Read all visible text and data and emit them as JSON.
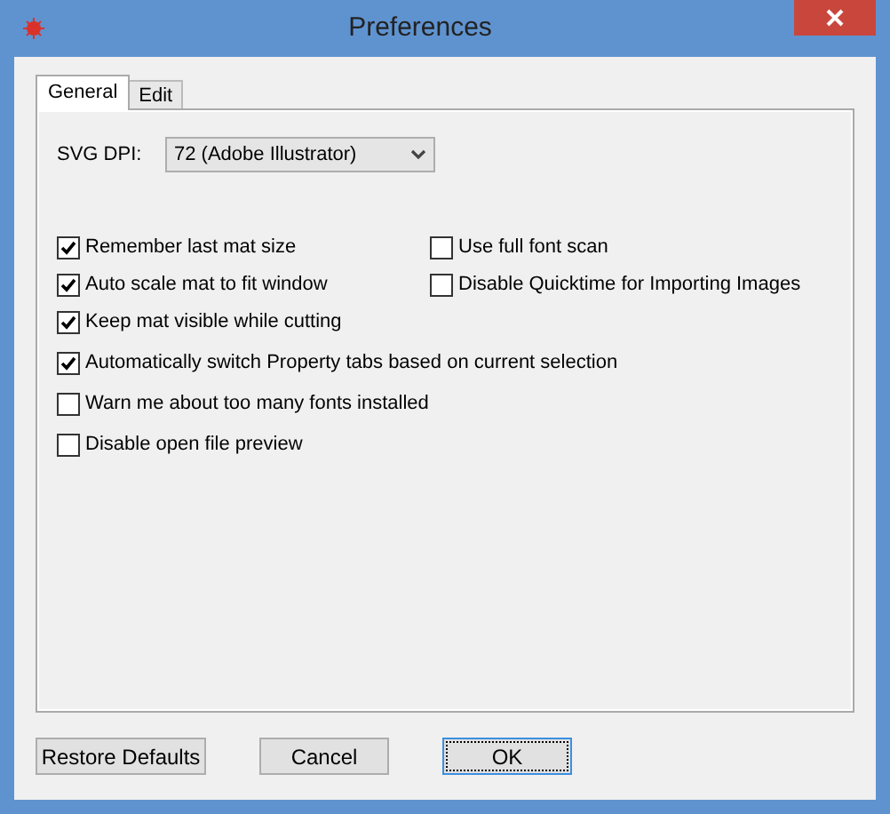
{
  "window": {
    "title": "Preferences"
  },
  "tabs": [
    {
      "label": "General",
      "selected": true
    },
    {
      "label": "Edit",
      "selected": false
    }
  ],
  "svg_dpi": {
    "label": "SVG DPI:",
    "value": "72 (Adobe Illustrator)"
  },
  "options": [
    {
      "label": "Remember last mat size",
      "checked": true
    },
    {
      "label": "Auto scale mat to fit window",
      "checked": true
    },
    {
      "label": "Keep mat visible while cutting",
      "checked": true
    },
    {
      "label": "Automatically switch Property tabs based on current selection",
      "checked": true
    },
    {
      "label": "Warn me about too many fonts installed",
      "checked": false
    },
    {
      "label": "Disable open file preview",
      "checked": false
    }
  ],
  "side_options": [
    {
      "label": "Use full font scan",
      "checked": false
    },
    {
      "label": "Disable Quicktime for Importing Images",
      "checked": false
    }
  ],
  "buttons": [
    {
      "label": "Restore Defaults",
      "default": false
    },
    {
      "label": "Cancel",
      "default": false
    },
    {
      "label": "OK",
      "default": true
    }
  ]
}
